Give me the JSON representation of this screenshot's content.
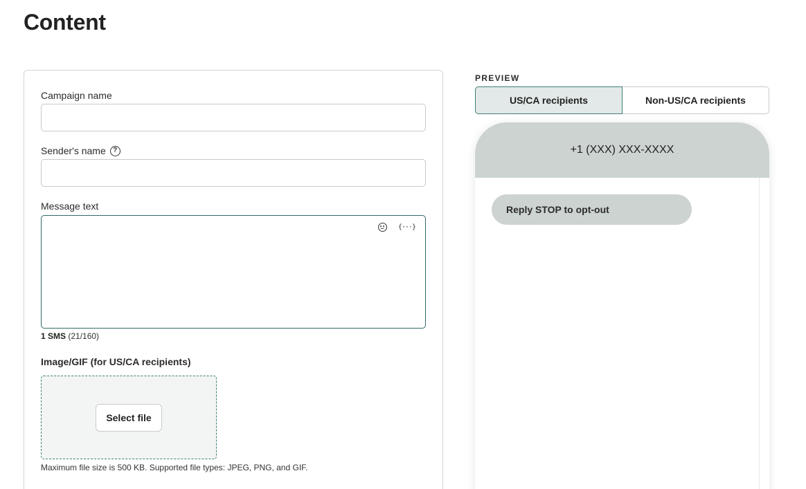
{
  "page_title": "Content",
  "form": {
    "campaign_name": {
      "label": "Campaign name",
      "value": "",
      "placeholder": ""
    },
    "sender_name": {
      "label": "Sender's name",
      "value": "",
      "placeholder": "",
      "help_icon": "question-circle-icon"
    },
    "message_text": {
      "label": "Message text",
      "value": "",
      "tools": [
        "emoji-icon",
        "variable-icon"
      ],
      "variable_glyph": "{···}"
    },
    "sms_count": {
      "count": "1 SMS",
      "detail": "(21/160)"
    },
    "image_upload": {
      "label": "Image/GIF (for US/CA recipients)",
      "button_label": "Select file",
      "hint": "Maximum file size is 500 KB. Supported file types: JPEG, PNG, and GIF."
    }
  },
  "preview": {
    "label": "PREVIEW",
    "tabs": [
      {
        "label": "US/CA recipients",
        "active": true
      },
      {
        "label": "Non-US/CA recipients",
        "active": false
      }
    ],
    "phone_number": "+1 (XXX) XXX-XXXX",
    "message_bubble": "Reply STOP to opt-out"
  },
  "colors": {
    "accent": "#3e7f78",
    "active_tab_bg": "#e3e9e8",
    "phone_header_bg": "#ccd3d1",
    "dropzone_bg": "#f3f5f4"
  }
}
